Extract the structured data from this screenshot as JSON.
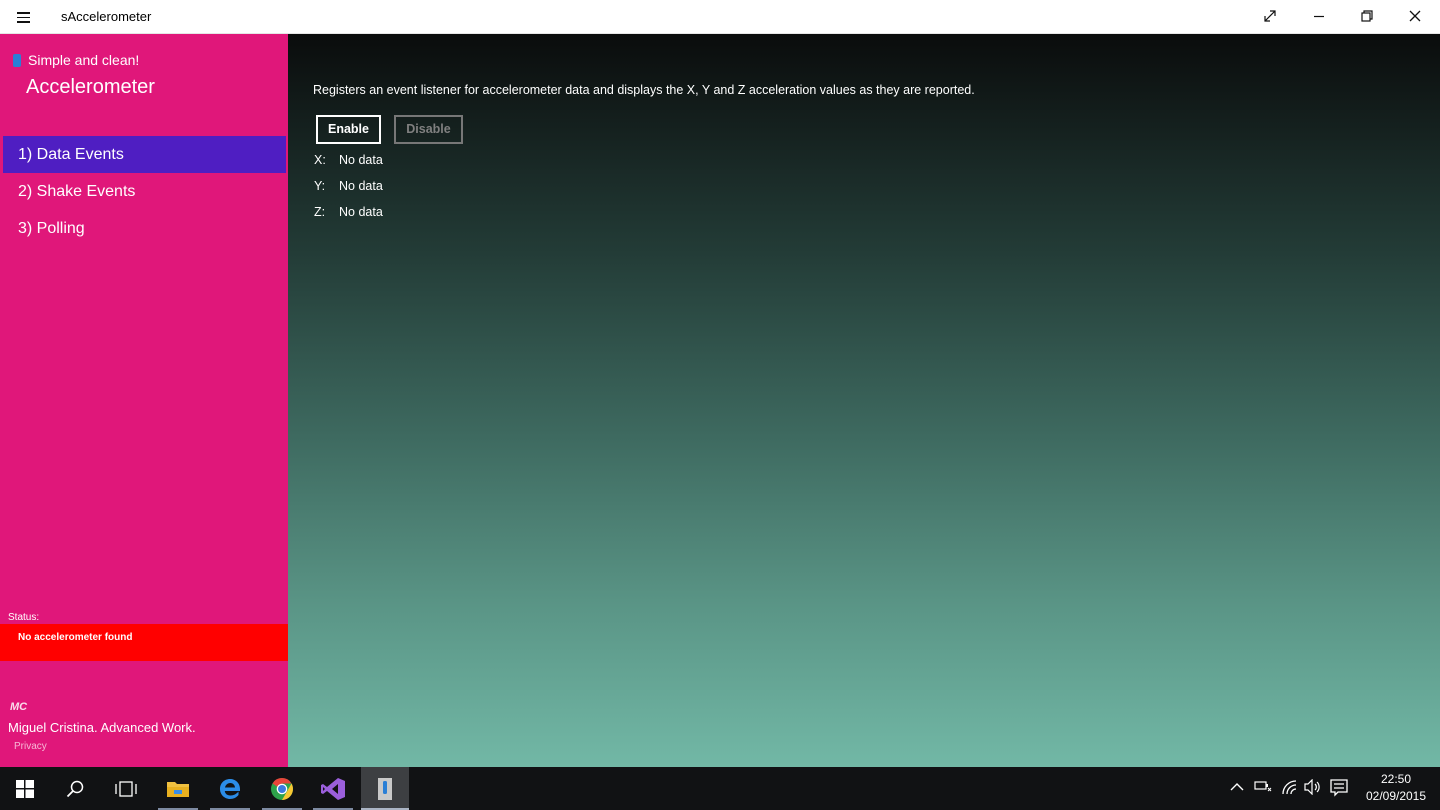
{
  "window": {
    "title": "sAccelerometer"
  },
  "sidebar": {
    "tagline": "Simple and clean!",
    "title": "Accelerometer",
    "nav": [
      {
        "label": "1) Data Events",
        "active": true
      },
      {
        "label": "2) Shake Events",
        "active": false
      },
      {
        "label": "3) Polling",
        "active": false
      }
    ],
    "status_label": "Status:",
    "status_message": "No accelerometer found",
    "logo_text": "MC",
    "author": "Miguel Cristina. Advanced Work.",
    "privacy": "Privacy"
  },
  "main": {
    "description": "Registers an event listener for accelerometer data and displays the X, Y and Z acceleration values as they are reported.",
    "enable_label": "Enable",
    "disable_label": "Disable",
    "readings": [
      {
        "axis": "X:",
        "value": "No data"
      },
      {
        "axis": "Y:",
        "value": "No data"
      },
      {
        "axis": "Z:",
        "value": "No data"
      }
    ]
  },
  "taskbar": {
    "apps": [
      "start-icon",
      "search-icon",
      "task-view-icon",
      "file-explorer-icon",
      "edge-icon",
      "chrome-icon",
      "visual-studio-icon",
      "accelerometer-app-icon"
    ],
    "time": "22:50",
    "date": "02/09/2015"
  },
  "colors": {
    "sidebar": "#e0177a",
    "nav_active": "#4f1ec2",
    "status_error": "#ff0000"
  }
}
